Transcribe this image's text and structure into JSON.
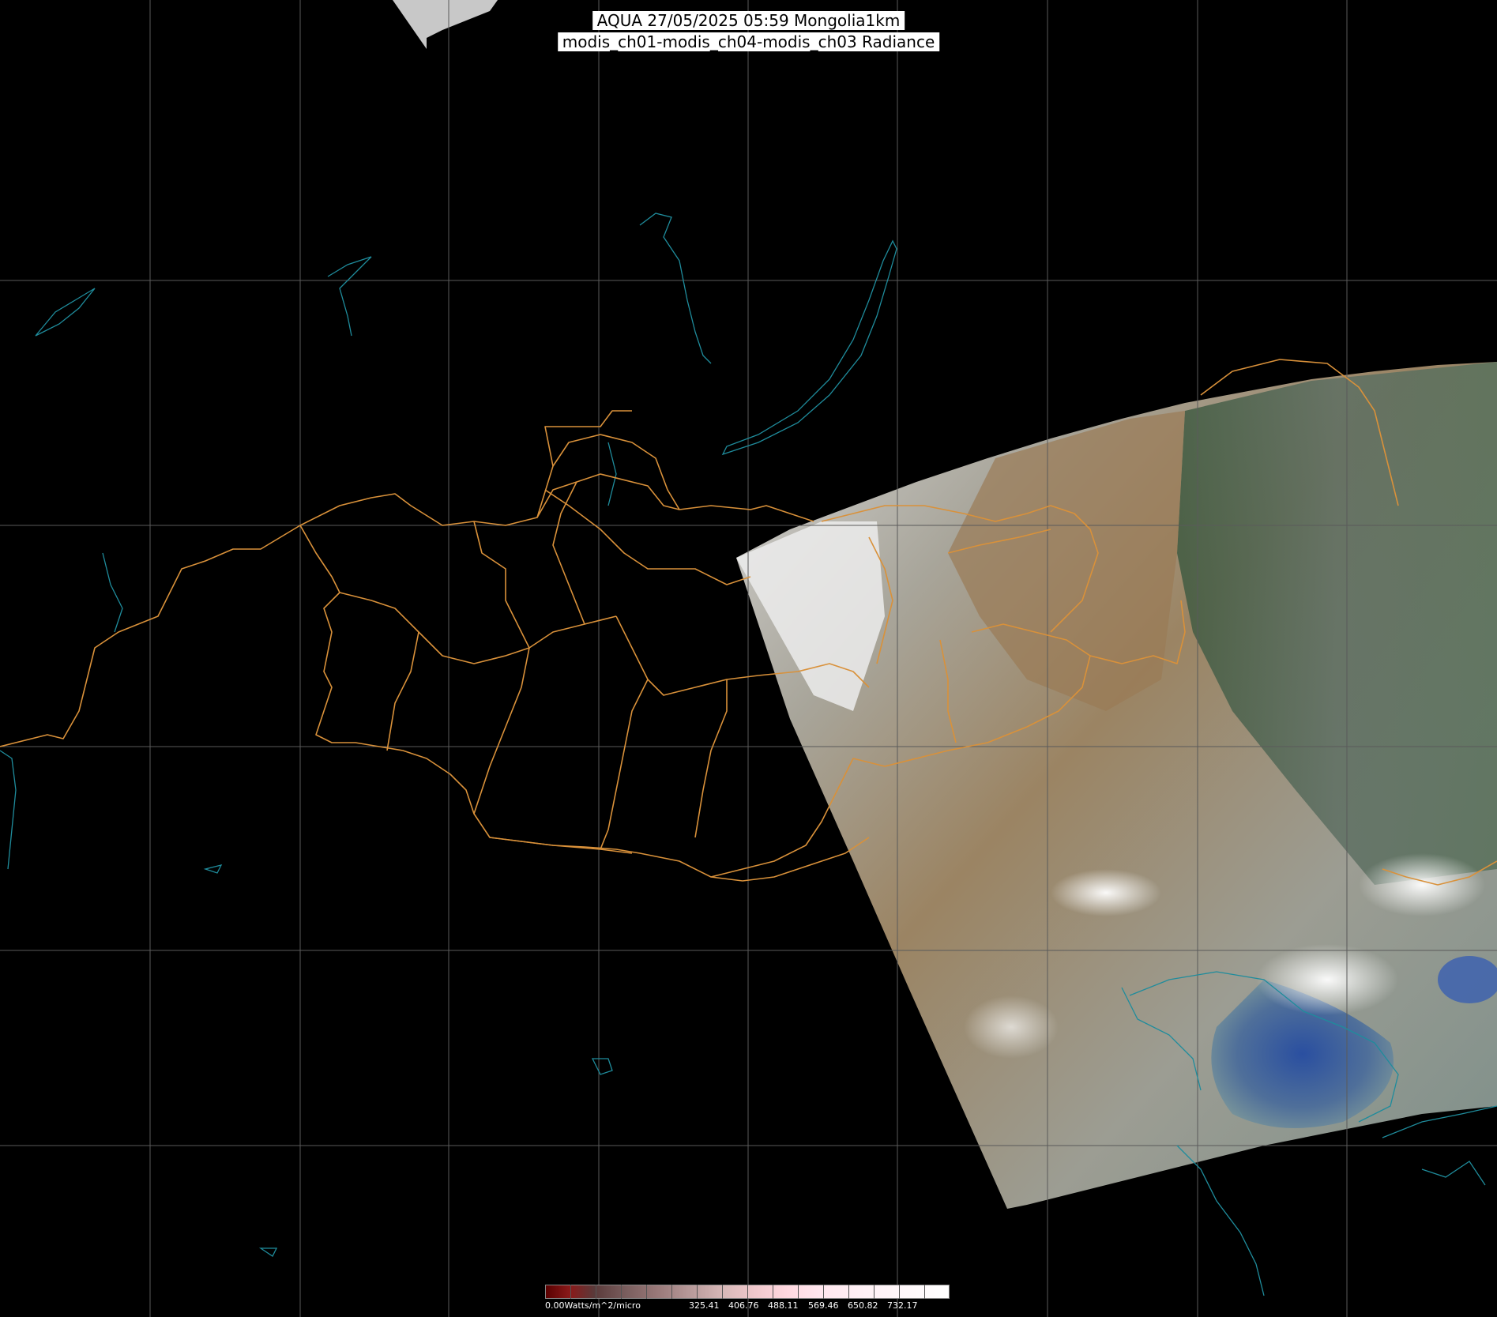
{
  "title": {
    "line1": "AQUA 27/05/2025 05:59 Mongolia1km",
    "line2": "modis_ch01-modis_ch04-modis_ch03 Radiance"
  },
  "colorbar": {
    "unit_label": "0.00Watts/m^2/micro",
    "ticks": [
      "325.41",
      "406.76",
      "488.11",
      "569.46",
      "650.82",
      "732.17"
    ]
  },
  "colors": {
    "background": "#000000",
    "grid": "#5a5a5a",
    "admin_border": "#d9913a",
    "coastline": "#1f8c9c",
    "cloud": "#eeeeee"
  }
}
